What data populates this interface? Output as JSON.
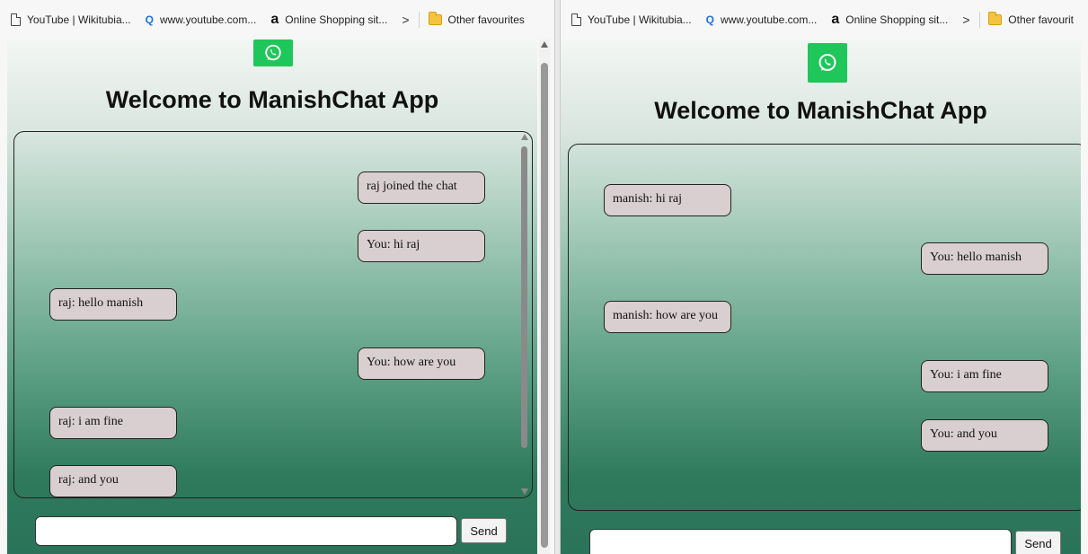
{
  "colors": {
    "whatsapp_green": "#1fc65a",
    "bubble_bg": "#d9cfd0"
  },
  "bookmarks": [
    {
      "label": "YouTube | Wikitubia...",
      "icon": "page-icon"
    },
    {
      "label": "www.youtube.com...",
      "icon": "search-icon"
    },
    {
      "label": "Online Shopping sit...",
      "icon": "amazon-icon"
    }
  ],
  "bookmarks_other": {
    "label": "Other favourites",
    "icon": "folder-icon"
  },
  "bookmarks_other_right": {
    "label": "Other favourit"
  },
  "chevron": ">",
  "search_glyph": "Q",
  "amazon_glyph": "a",
  "app": {
    "title": "Welcome to ManishChat App",
    "send_label": "Send",
    "input_value": ""
  },
  "left_window": {
    "messages": [
      {
        "text": "raj joined the chat",
        "side": "right"
      },
      {
        "text": "You: hi raj",
        "side": "right"
      },
      {
        "text": "raj: hello manish",
        "side": "left"
      },
      {
        "text": "You: how are you",
        "side": "right"
      },
      {
        "text": "raj: i am fine",
        "side": "left"
      },
      {
        "text": "raj: and you",
        "side": "left"
      }
    ]
  },
  "right_window": {
    "messages": [
      {
        "text": "manish: hi raj",
        "side": "left"
      },
      {
        "text": "You: hello manish",
        "side": "right"
      },
      {
        "text": "manish: how are you",
        "side": "left"
      },
      {
        "text": "You: i am fine",
        "side": "right"
      },
      {
        "text": "You: and you",
        "side": "right"
      }
    ]
  }
}
